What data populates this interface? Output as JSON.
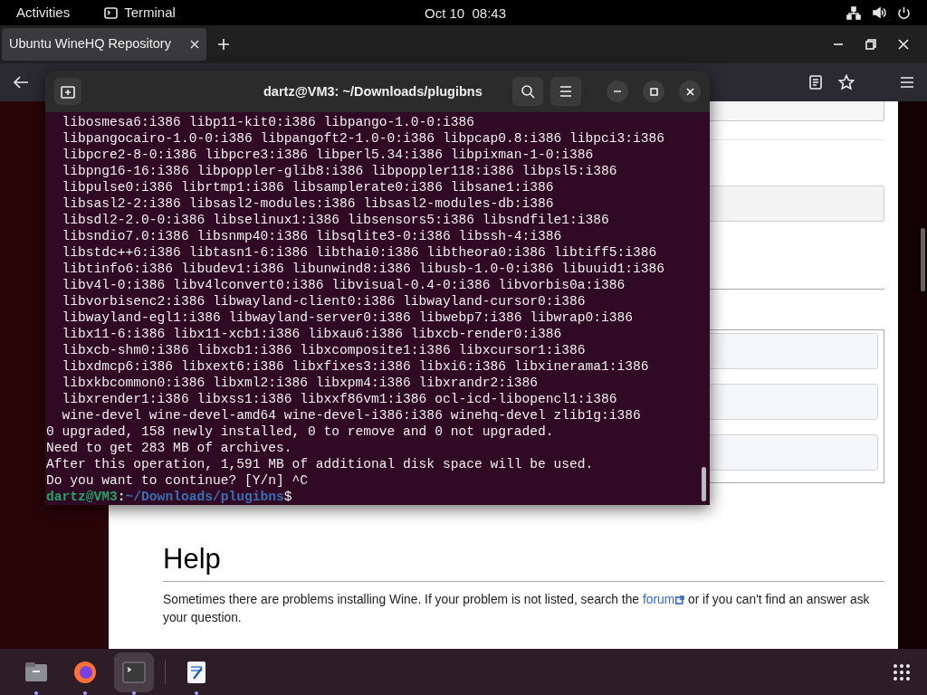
{
  "top_bar": {
    "activities": "Activities",
    "app": "Terminal",
    "clock": "Oct 10  08:43"
  },
  "browser": {
    "tabs": [
      {
        "label": "Ubuntu WineHQ Repository",
        "selected": true
      }
    ],
    "page": {
      "heading": "Help",
      "paragraph": {
        "before": "Sometimes there are problems installing Wine. If your problem is not listed, search the ",
        "link": "forum",
        "after": " or if you can't find an answer ask your question."
      }
    }
  },
  "terminal": {
    "title": "dartz@VM3: ~/Downloads/plugibns",
    "lines": [
      {
        "kind": "output",
        "text": "  libosmesa6:i386 libp11-kit0:i386 libpango-1.0-0:i386"
      },
      {
        "kind": "output",
        "text": "  libpangocairo-1.0-0:i386 libpangoft2-1.0-0:i386 libpcap0.8:i386 libpci3:i386"
      },
      {
        "kind": "output",
        "text": "  libpcre2-8-0:i386 libpcre3:i386 libperl5.34:i386 libpixman-1-0:i386"
      },
      {
        "kind": "output",
        "text": "  libpng16-16:i386 libpoppler-glib8:i386 libpoppler118:i386 libpsl5:i386"
      },
      {
        "kind": "output",
        "text": "  libpulse0:i386 librtmp1:i386 libsamplerate0:i386 libsane1:i386"
      },
      {
        "kind": "output",
        "text": "  libsasl2-2:i386 libsasl2-modules:i386 libsasl2-modules-db:i386"
      },
      {
        "kind": "output",
        "text": "  libsdl2-2.0-0:i386 libselinux1:i386 libsensors5:i386 libsndfile1:i386"
      },
      {
        "kind": "output",
        "text": "  libsndio7.0:i386 libsnmp40:i386 libsqlite3-0:i386 libssh-4:i386"
      },
      {
        "kind": "output",
        "text": "  libstdc++6:i386 libtasn1-6:i386 libthai0:i386 libtheora0:i386 libtiff5:i386"
      },
      {
        "kind": "output",
        "text": "  libtinfo6:i386 libudev1:i386 libunwind8:i386 libusb-1.0-0:i386 libuuid1:i386"
      },
      {
        "kind": "output",
        "text": "  libv4l-0:i386 libv4lconvert0:i386 libvisual-0.4-0:i386 libvorbis0a:i386"
      },
      {
        "kind": "output",
        "text": "  libvorbisenc2:i386 libwayland-client0:i386 libwayland-cursor0:i386"
      },
      {
        "kind": "output",
        "text": "  libwayland-egl1:i386 libwayland-server0:i386 libwebp7:i386 libwrap0:i386"
      },
      {
        "kind": "output",
        "text": "  libx11-6:i386 libx11-xcb1:i386 libxau6:i386 libxcb-render0:i386"
      },
      {
        "kind": "output",
        "text": "  libxcb-shm0:i386 libxcb1:i386 libxcomposite1:i386 libxcursor1:i386"
      },
      {
        "kind": "output",
        "text": "  libxdmcp6:i386 libxext6:i386 libxfixes3:i386 libxi6:i386 libxinerama1:i386"
      },
      {
        "kind": "output",
        "text": "  libxkbcommon0:i386 libxml2:i386 libxpm4:i386 libxrandr2:i386"
      },
      {
        "kind": "output",
        "text": "  libxrender1:i386 libxss1:i386 libxxf86vm1:i386 ocl-icd-libopencl1:i386"
      },
      {
        "kind": "output",
        "text": "  wine-devel wine-devel-amd64 wine-devel-i386:i386 winehq-devel zlib1g:i386"
      },
      {
        "kind": "output",
        "text": "0 upgraded, 158 newly installed, 0 to remove and 0 not upgraded."
      },
      {
        "kind": "output",
        "text": "Need to get 283 MB of archives."
      },
      {
        "kind": "output",
        "text": "After this operation, 1,591 MB of additional disk space will be used."
      },
      {
        "kind": "output",
        "text": "Do you want to continue? [Y/n] ^C"
      },
      {
        "kind": "prompt",
        "user": "dartz@VM3",
        "sep": ":",
        "path": "~/Downloads/plugibns",
        "symbol": "$"
      }
    ]
  },
  "dock": [
    {
      "kind": "files",
      "running": true,
      "selected": false
    },
    {
      "kind": "firefox",
      "running": true,
      "selected": false
    },
    {
      "kind": "terminal",
      "running": true,
      "selected": true
    },
    {
      "kind": "editor",
      "running": true,
      "selected": false
    }
  ]
}
